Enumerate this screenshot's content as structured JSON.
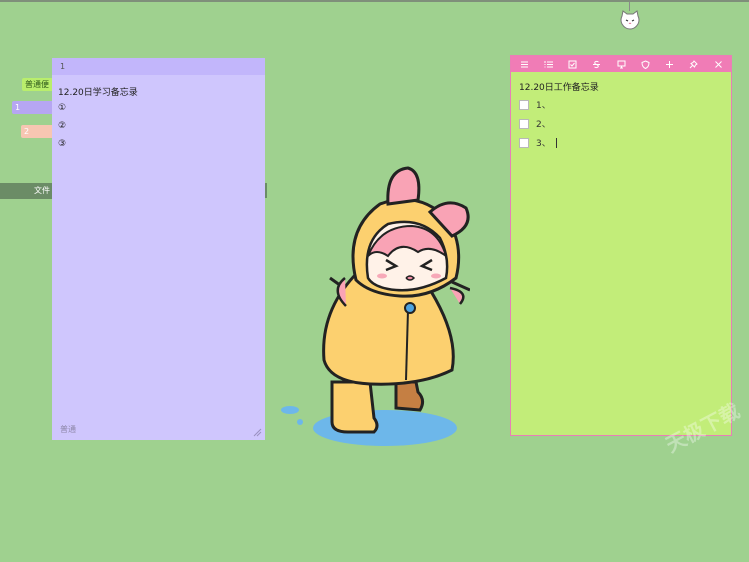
{
  "left_tabs": {
    "green_label": "普通便",
    "purple_label": "1",
    "peach_label": "2",
    "file_bar": "文件"
  },
  "study_note": {
    "title_bar": "1",
    "heading": "12.20日学习备忘录",
    "lines": [
      "①",
      "②",
      "③"
    ],
    "footer": "普通"
  },
  "work_note": {
    "toolbar_icons": [
      "list-icon",
      "ordered-list-icon",
      "checkbox-icon",
      "strikethrough-icon",
      "monitor-icon",
      "shield-icon",
      "add-icon",
      "pin-icon",
      "close-icon"
    ],
    "heading": "12.20日工作备忘录",
    "todos": [
      "1、",
      "2、",
      "3、"
    ]
  },
  "watermark": "天极下载",
  "colors": {
    "desktop": "#9fd18f",
    "purple_note": "#cfc6fd",
    "green_note": "#c2ed79",
    "pink_toolbar": "#f07cb6"
  }
}
